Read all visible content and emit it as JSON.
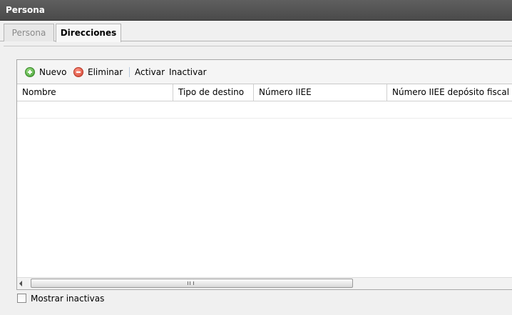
{
  "window": {
    "title": "Persona"
  },
  "tabs": [
    {
      "label": "Persona",
      "active": false
    },
    {
      "label": "Direcciones",
      "active": true
    }
  ],
  "toolbar": {
    "new_label": "Nuevo",
    "new_icon": "add-circle-icon",
    "delete_label": "Eliminar",
    "delete_icon": "remove-circle-icon",
    "activate_label": "Activar",
    "deactivate_label": "Inactivar"
  },
  "grid": {
    "columns": [
      "Nombre",
      "Tipo de destino",
      "Número IIEE",
      "Número IIEE depósito fiscal"
    ],
    "rows": []
  },
  "footer": {
    "show_inactive_label": "Mostrar inactivas",
    "show_inactive_checked": false
  },
  "colors": {
    "titlebar": "#4f4f4f",
    "add": "#3f9a2e",
    "delete": "#d0402e"
  }
}
